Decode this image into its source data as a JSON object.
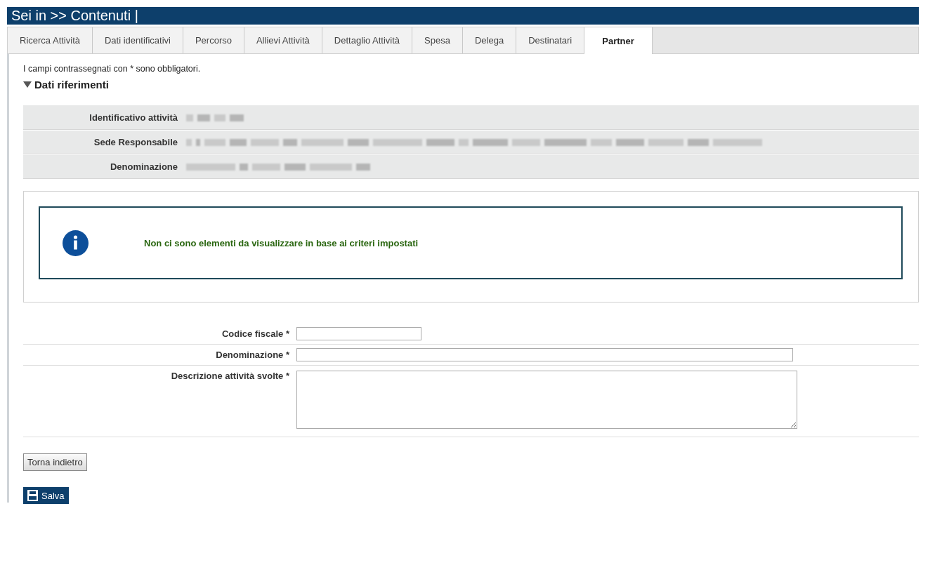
{
  "header": {
    "title": "Sei in >> Contenuti |"
  },
  "tabs": [
    {
      "label": "Ricerca Attività",
      "selected": false
    },
    {
      "label": "Dati identificativi",
      "selected": false
    },
    {
      "label": "Percorso",
      "selected": false
    },
    {
      "label": "Allievi Attività",
      "selected": false
    },
    {
      "label": "Dettaglio Attività",
      "selected": false
    },
    {
      "label": "Spesa",
      "selected": false
    },
    {
      "label": "Delega",
      "selected": false
    },
    {
      "label": "Destinatari",
      "selected": false
    },
    {
      "label": "Partner",
      "selected": true
    }
  ],
  "note": "I campi contrassegnati con * sono obbligatori.",
  "section": {
    "title": "Dati riferimenti",
    "expanded": true,
    "rows": [
      {
        "label": "Identificativo attività"
      },
      {
        "label": "Sede Responsabile"
      },
      {
        "label": "Denominazione"
      }
    ]
  },
  "message": {
    "text": "Non ci sono elementi da visualizzare in base ai criteri impostati"
  },
  "form": [
    {
      "label": "Codice fiscale *",
      "kind": "short"
    },
    {
      "label": "Denominazione *",
      "kind": "long"
    },
    {
      "label": "Descrizione attività svolte *",
      "kind": "area"
    }
  ],
  "buttons": [
    {
      "label": "Torna indietro",
      "kind": "plain"
    },
    {
      "label": "Salva",
      "kind": "save"
    }
  ]
}
